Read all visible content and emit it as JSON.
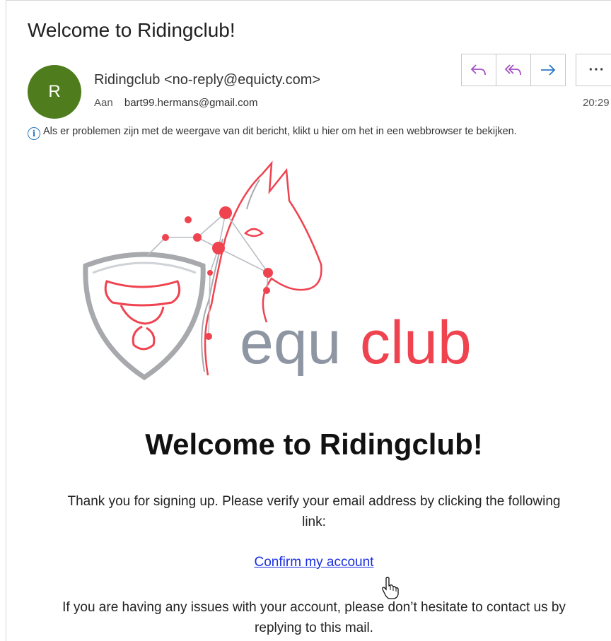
{
  "email": {
    "subject": "Welcome to Ridingclub!",
    "avatar_initial": "R",
    "sender": "Ridingclub <no-reply@equicty.com>",
    "to_label": "Aan",
    "to_address": "bart99.hermans@gmail.com",
    "time": "20:29",
    "more_label": "···",
    "info_message": "Als er problemen zijn met de weergave van dit bericht, klikt u hier om het in een webbrowser te bekijken."
  },
  "actions": [
    {
      "name": "reply-icon"
    },
    {
      "name": "reply-all-icon"
    },
    {
      "name": "forward-icon"
    },
    {
      "name": "more-icon"
    }
  ],
  "logo": {
    "word_part1": "equ",
    "word_part2": "club",
    "colors": {
      "gray": "#8d96a2",
      "red": "#ef4350"
    }
  },
  "body": {
    "title": "Welcome to Ridingclub!",
    "intro": "Thank you for signing up. Please verify your email address by clicking the following link:",
    "confirm_link": "Confirm my account",
    "outro": "If you are having any issues with your account, please don’t hesitate to contact us by replying to this mail."
  },
  "colors": {
    "avatar": "#4f7d1d",
    "reply_icon": "#a44fc4",
    "forward_icon": "#2b78c5",
    "link": "#1a2ee0"
  }
}
